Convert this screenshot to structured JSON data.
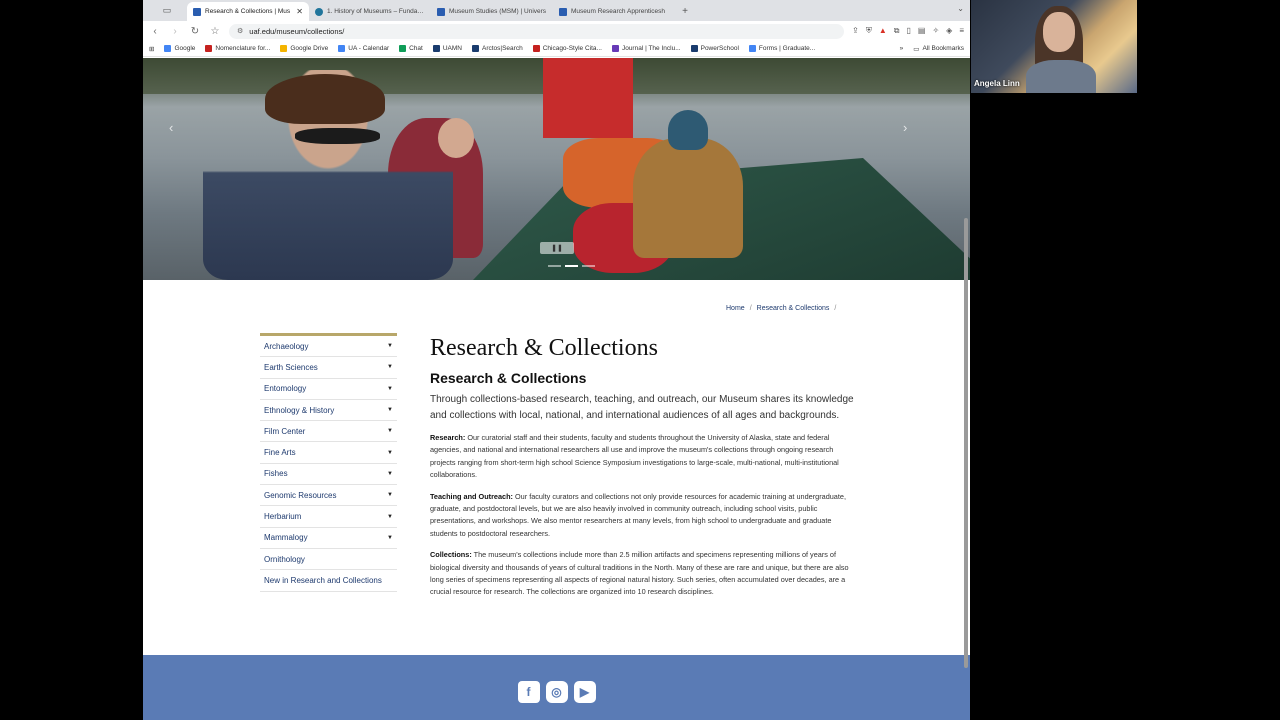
{
  "browser": {
    "tabs": [
      {
        "label": "Research & Collections | Mus",
        "active": true,
        "icon": "uaf-icon"
      },
      {
        "label": "1. History of Museums – Fundame",
        "active": false,
        "icon": "wordpress-icon"
      },
      {
        "label": "Museum Studies (MSM) | Univers",
        "active": false,
        "icon": "uaf-icon"
      },
      {
        "label": "Museum Research Apprenticesh",
        "active": false,
        "icon": "uaf-icon"
      }
    ],
    "url": "uaf.edu/museum/collections/",
    "bookmarks": [
      {
        "label": "Google",
        "icon": "google-icon"
      },
      {
        "label": "Nomenclature for...",
        "icon": "bookmark-icon"
      },
      {
        "label": "Google Drive",
        "icon": "drive-icon"
      },
      {
        "label": "UA - Calendar",
        "icon": "calendar-icon"
      },
      {
        "label": "Chat",
        "icon": "chat-icon"
      },
      {
        "label": "UAMN",
        "icon": "bookmark-icon"
      },
      {
        "label": "Arctos|Search",
        "icon": "bookmark-icon"
      },
      {
        "label": "Chicago-Style Cita...",
        "icon": "bookmark-icon"
      },
      {
        "label": "Journal | The Inclu...",
        "icon": "bookmark-icon"
      },
      {
        "label": "PowerSchool",
        "icon": "bookmark-icon"
      },
      {
        "label": "Forms | Graduate...",
        "icon": "bookmark-icon"
      }
    ],
    "all_bookmarks": "All Bookmarks"
  },
  "page": {
    "breadcrumb": {
      "home": "Home",
      "current": "Research & Collections",
      "sep": "/"
    },
    "sidenav": [
      {
        "label": "Archaeology",
        "caret": true
      },
      {
        "label": "Earth Sciences",
        "caret": true
      },
      {
        "label": "Entomology",
        "caret": true
      },
      {
        "label": "Ethnology & History",
        "caret": true
      },
      {
        "label": "Film Center",
        "caret": true
      },
      {
        "label": "Fine Arts",
        "caret": true
      },
      {
        "label": "Fishes",
        "caret": true
      },
      {
        "label": "Genomic Resources",
        "caret": true
      },
      {
        "label": "Herbarium",
        "caret": true
      },
      {
        "label": "Mammalogy",
        "caret": true
      },
      {
        "label": "Ornithology",
        "caret": false
      },
      {
        "label": "New in Research and Collections",
        "caret": false
      }
    ],
    "title": "Research & Collections",
    "subtitle": "Research & Collections",
    "lead": "Through collections-based research, teaching, and outreach, our Museum shares its knowledge and collections with local, national, and international audiences of all ages and backgrounds.",
    "paragraphs": [
      {
        "label": "Research:",
        "text": " Our curatorial staff and their students, faculty and students throughout the University of Alaska, state and federal agencies, and national and international researchers all use and improve the museum's collections through ongoing research projects ranging from short-term high school Science Symposium investigations to large-scale, multi-national, multi-institutional collaborations."
      },
      {
        "label": "Teaching and Outreach:",
        "text": " Our faculty curators and collections not only provide resources for academic training at undergraduate, graduate, and postdoctoral levels, but we are also heavily involved in community outreach, including school visits, public presentations, and workshops. We also mentor researchers at many levels, from high school to undergraduate and graduate students to postdoctoral researchers."
      },
      {
        "label": "Collections:",
        "text": " The museum's collections include more than 2.5 million artifacts and specimens representing millions of years of biological diversity and thousands of years of cultural traditions in the North. Many of these are rare and unique, but there are also long series of specimens representing all aspects of regional natural history. Such series, often accumulated over decades, are a crucial resource for research. The collections are organized into 10 research disciplines."
      }
    ],
    "social": [
      {
        "icon": "facebook-icon",
        "glyph": "f"
      },
      {
        "icon": "instagram-icon",
        "glyph": "◎"
      },
      {
        "icon": "youtube-icon",
        "glyph": "▶"
      }
    ],
    "colors": {
      "footer": "#5a7bb5",
      "nav_accent": "#b8a76a",
      "link": "#1e3a6e"
    }
  },
  "video": {
    "participant": "Angela Linn"
  }
}
